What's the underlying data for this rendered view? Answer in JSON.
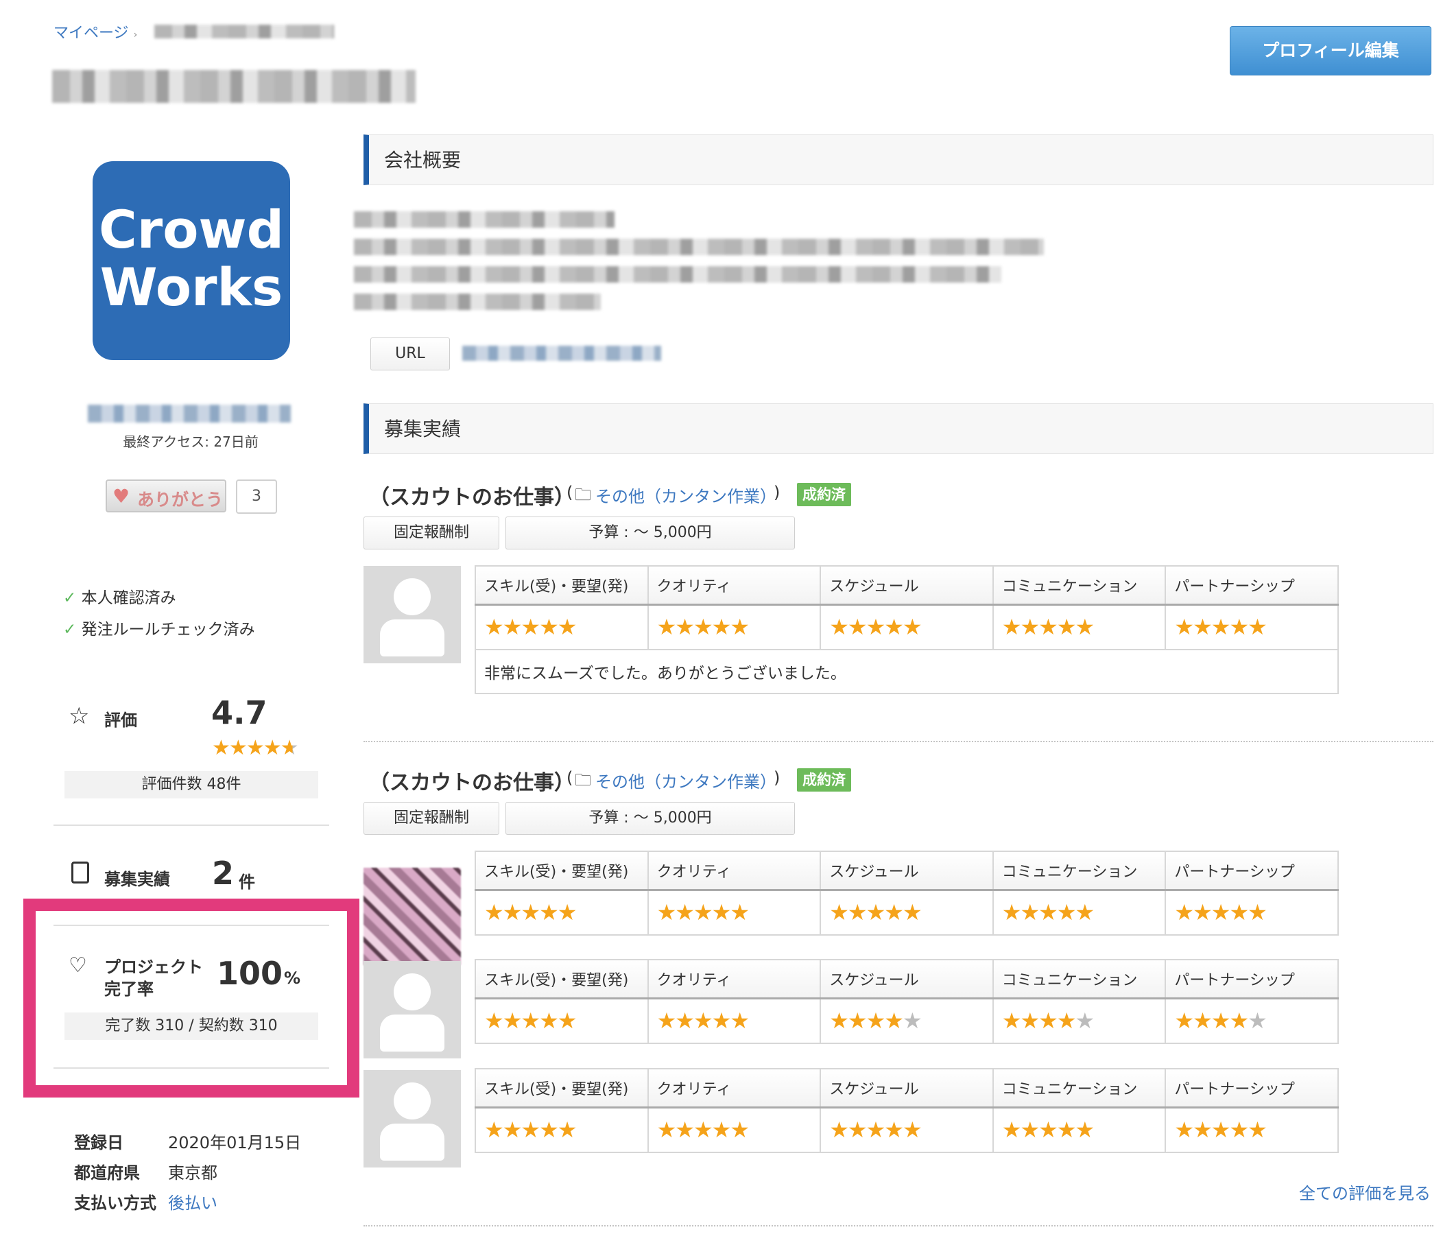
{
  "breadcrumb": {
    "home": "マイページ",
    "sep": "›"
  },
  "edit_button": "プロフィール編集",
  "logo": {
    "line1": "Crowd",
    "line2": "Works",
    "bg": "#2d6cb5"
  },
  "last_access": "最終アクセス: 27日前",
  "thanks": {
    "label": "ありがとう",
    "count": "3"
  },
  "verifications": [
    "本人確認済み",
    "発注ルールチェック済み"
  ],
  "rating": {
    "label": "評価",
    "value": "4.7",
    "count_text": "評価件数 48件",
    "stars": 4.7
  },
  "recruit": {
    "label": "募集実績",
    "value": "2",
    "unit": "件"
  },
  "completion": {
    "label1": "プロジェクト",
    "label2": "完了率",
    "value": "100",
    "unit": "%",
    "detail": "完了数 310 / 契約数 310"
  },
  "info": [
    {
      "k": "登録日",
      "v": "2020年01月15日"
    },
    {
      "k": "都道府県",
      "v": "東京都"
    },
    {
      "k": "支払い方式",
      "v": "後払い"
    }
  ],
  "company": {
    "heading": "会社概要",
    "url_label": "URL"
  },
  "history": {
    "heading": "募集実績",
    "see_all": "全ての評価を見る"
  },
  "review_headers": [
    "スキル(受)・要望(発)",
    "クオリティ",
    "スケジュール",
    "コミュニケーション",
    "パートナーシップ"
  ],
  "jobs": [
    {
      "title": "（スカウトのお仕事）",
      "cat_open": "(",
      "category": "その他（カンタン作業）",
      "cat_close": ")",
      "status": "成約済",
      "type": "固定報酬制",
      "budget": "予算 : 〜 5,000円"
    },
    {
      "title": "（スカウトのお仕事）",
      "cat_open": "(",
      "category": "その他（カンタン作業）",
      "cat_close": ")",
      "status": "成約済",
      "type": "固定報酬制",
      "budget": "予算 : 〜 5,000円"
    }
  ],
  "comment1": "非常にスムーズでした。ありがとうございました。",
  "review_scores": [
    [
      5,
      5,
      5,
      5,
      5
    ],
    [
      5,
      5,
      5,
      5,
      5
    ],
    [
      5,
      5,
      4,
      4,
      4
    ],
    [
      5,
      5,
      5,
      5,
      5
    ]
  ]
}
